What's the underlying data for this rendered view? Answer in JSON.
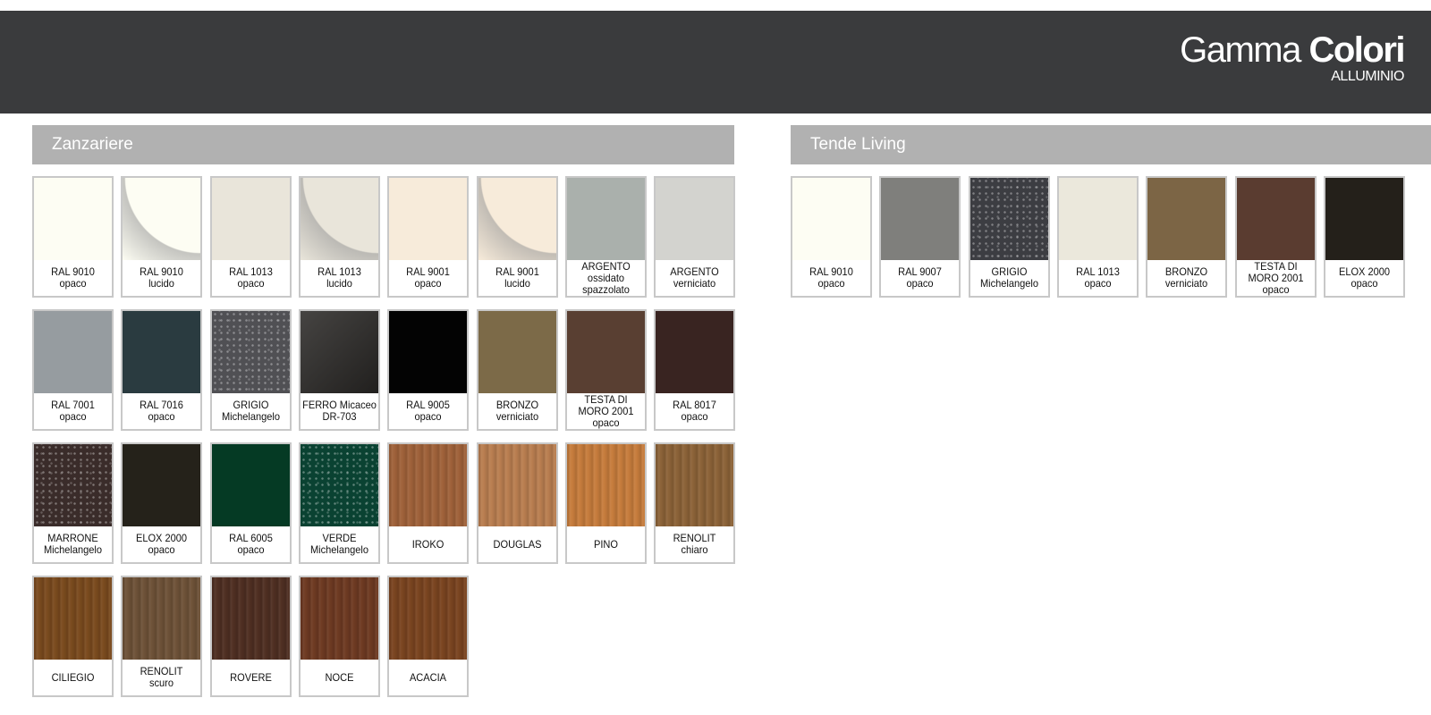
{
  "header": {
    "title_light": "Gamma",
    "title_bold": "Colori",
    "subtitle": "ALLUMINIO"
  },
  "colors": {
    "header_bg": "#3a3b3d",
    "section_bar": "#b1b1b1"
  },
  "sections": [
    {
      "title": "Zanzariere",
      "swatches": [
        {
          "lines": [
            "RAL 9010",
            "opaco"
          ],
          "color": "#fdfdf3",
          "finish": "flat"
        },
        {
          "lines": [
            "RAL 9010",
            "lucido"
          ],
          "color": "#fdfdf3",
          "finish": "gloss"
        },
        {
          "lines": [
            "RAL 1013",
            "opaco"
          ],
          "color": "#e9e5da",
          "finish": "flat"
        },
        {
          "lines": [
            "RAL 1013",
            "lucido"
          ],
          "color": "#e9e5da",
          "finish": "gloss"
        },
        {
          "lines": [
            "RAL 9001",
            "opaco"
          ],
          "color": "#f7ebda",
          "finish": "flat"
        },
        {
          "lines": [
            "RAL 9001",
            "lucido"
          ],
          "color": "#f7ebda",
          "finish": "gloss"
        },
        {
          "lines": [
            "ARGENTO",
            "ossidato",
            "spazzolato"
          ],
          "color": "#aab0ac",
          "finish": "flat"
        },
        {
          "lines": [
            "ARGENTO",
            "verniciato"
          ],
          "color": "#d3d3cf",
          "finish": "flat"
        },
        {
          "lines": [
            "RAL 7001",
            "opaco"
          ],
          "color": "#969ca0",
          "finish": "flat"
        },
        {
          "lines": [
            "RAL 7016",
            "opaco"
          ],
          "color": "#2a3b40",
          "finish": "flat"
        },
        {
          "lines": [
            "GRIGIO",
            "Michelangelo"
          ],
          "color": "#505054",
          "finish": "speckle"
        },
        {
          "lines": [
            "FERRO Micaceo",
            "DR-703"
          ],
          "color": "#2c2a28",
          "finish": "metal"
        },
        {
          "lines": [
            "RAL 9005",
            "opaco"
          ],
          "color": "#030303",
          "finish": "flat"
        },
        {
          "lines": [
            "BRONZO",
            "verniciato"
          ],
          "color": "#7c6a48",
          "finish": "flat"
        },
        {
          "lines": [
            "TESTA DI",
            "MORO 2001",
            "opaco"
          ],
          "color": "#593f32",
          "finish": "flat"
        },
        {
          "lines": [
            "RAL 8017",
            "opaco"
          ],
          "color": "#392421",
          "finish": "flat"
        },
        {
          "lines": [
            "MARRONE",
            "Michelangelo"
          ],
          "color": "#3a2c2a",
          "finish": "speckle"
        },
        {
          "lines": [
            "ELOX 2000",
            "opaco"
          ],
          "color": "#25221a",
          "finish": "flat"
        },
        {
          "lines": [
            "RAL 6005",
            "opaco"
          ],
          "color": "#053a24",
          "finish": "flat"
        },
        {
          "lines": [
            "VERDE",
            "Michelangelo"
          ],
          "color": "#0a4232",
          "finish": "speckle"
        },
        {
          "lines": [
            "IROKO"
          ],
          "color": "#a0623a",
          "finish": "wood"
        },
        {
          "lines": [
            "DOUGLAS"
          ],
          "color": "#b97e50",
          "finish": "wood"
        },
        {
          "lines": [
            "PINO"
          ],
          "color": "#c67c3c",
          "finish": "wood"
        },
        {
          "lines": [
            "RENOLIT",
            "chiaro"
          ],
          "color": "#8c6338",
          "finish": "wood"
        },
        {
          "lines": [
            "CILIEGIO"
          ],
          "color": "#7a4a1e",
          "finish": "wood"
        },
        {
          "lines": [
            "RENOLIT",
            "scuro"
          ],
          "color": "#6e5238",
          "finish": "wood"
        },
        {
          "lines": [
            "ROVERE"
          ],
          "color": "#4f2f22",
          "finish": "wood"
        },
        {
          "lines": [
            "NOCE"
          ],
          "color": "#6e3a22",
          "finish": "wood"
        },
        {
          "lines": [
            "ACACIA"
          ],
          "color": "#7a4420",
          "finish": "wood"
        }
      ]
    },
    {
      "title": "Tende Living",
      "swatches": [
        {
          "lines": [
            "RAL 9010",
            "opaco"
          ],
          "color": "#fdfdf3",
          "finish": "flat"
        },
        {
          "lines": [
            "RAL 9007",
            "opaco"
          ],
          "color": "#7f7f7c",
          "finish": "flat"
        },
        {
          "lines": [
            "GRIGIO",
            "Michelangelo"
          ],
          "color": "#3c3d42",
          "finish": "speckle"
        },
        {
          "lines": [
            "RAL 1013",
            "opaco"
          ],
          "color": "#ebe8dc",
          "finish": "flat"
        },
        {
          "lines": [
            "BRONZO",
            "verniciato"
          ],
          "color": "#7c6545",
          "finish": "flat"
        },
        {
          "lines": [
            "TESTA DI",
            "MORO 2001",
            "opaco"
          ],
          "color": "#5a3c30",
          "finish": "flat"
        },
        {
          "lines": [
            "ELOX 2000",
            "opaco"
          ],
          "color": "#24201a",
          "finish": "flat"
        }
      ]
    }
  ]
}
